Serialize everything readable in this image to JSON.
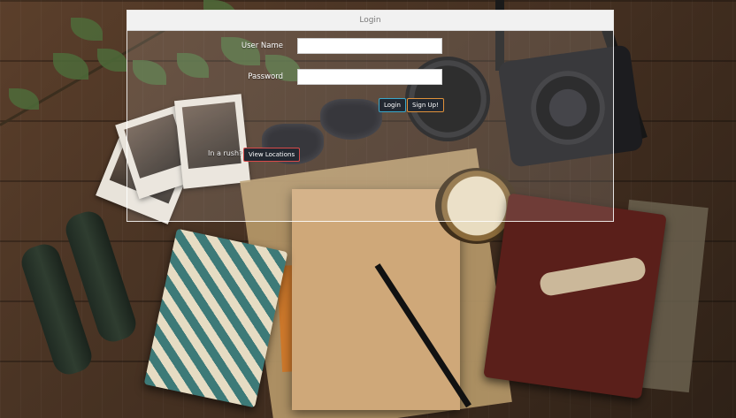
{
  "panel": {
    "title": "Login"
  },
  "form": {
    "username_label": "User Name",
    "username_value": "",
    "password_label": "Password",
    "password_value": ""
  },
  "buttons": {
    "login": "Login",
    "signup": "Sign Up!",
    "view_locations": "View Locations"
  },
  "rush_text": "In a rush?",
  "colors": {
    "login_border": "#3aa7c9",
    "signup_border": "#e0913a",
    "view_locations_border": "#d84a4a",
    "button_bg": "#222831"
  }
}
